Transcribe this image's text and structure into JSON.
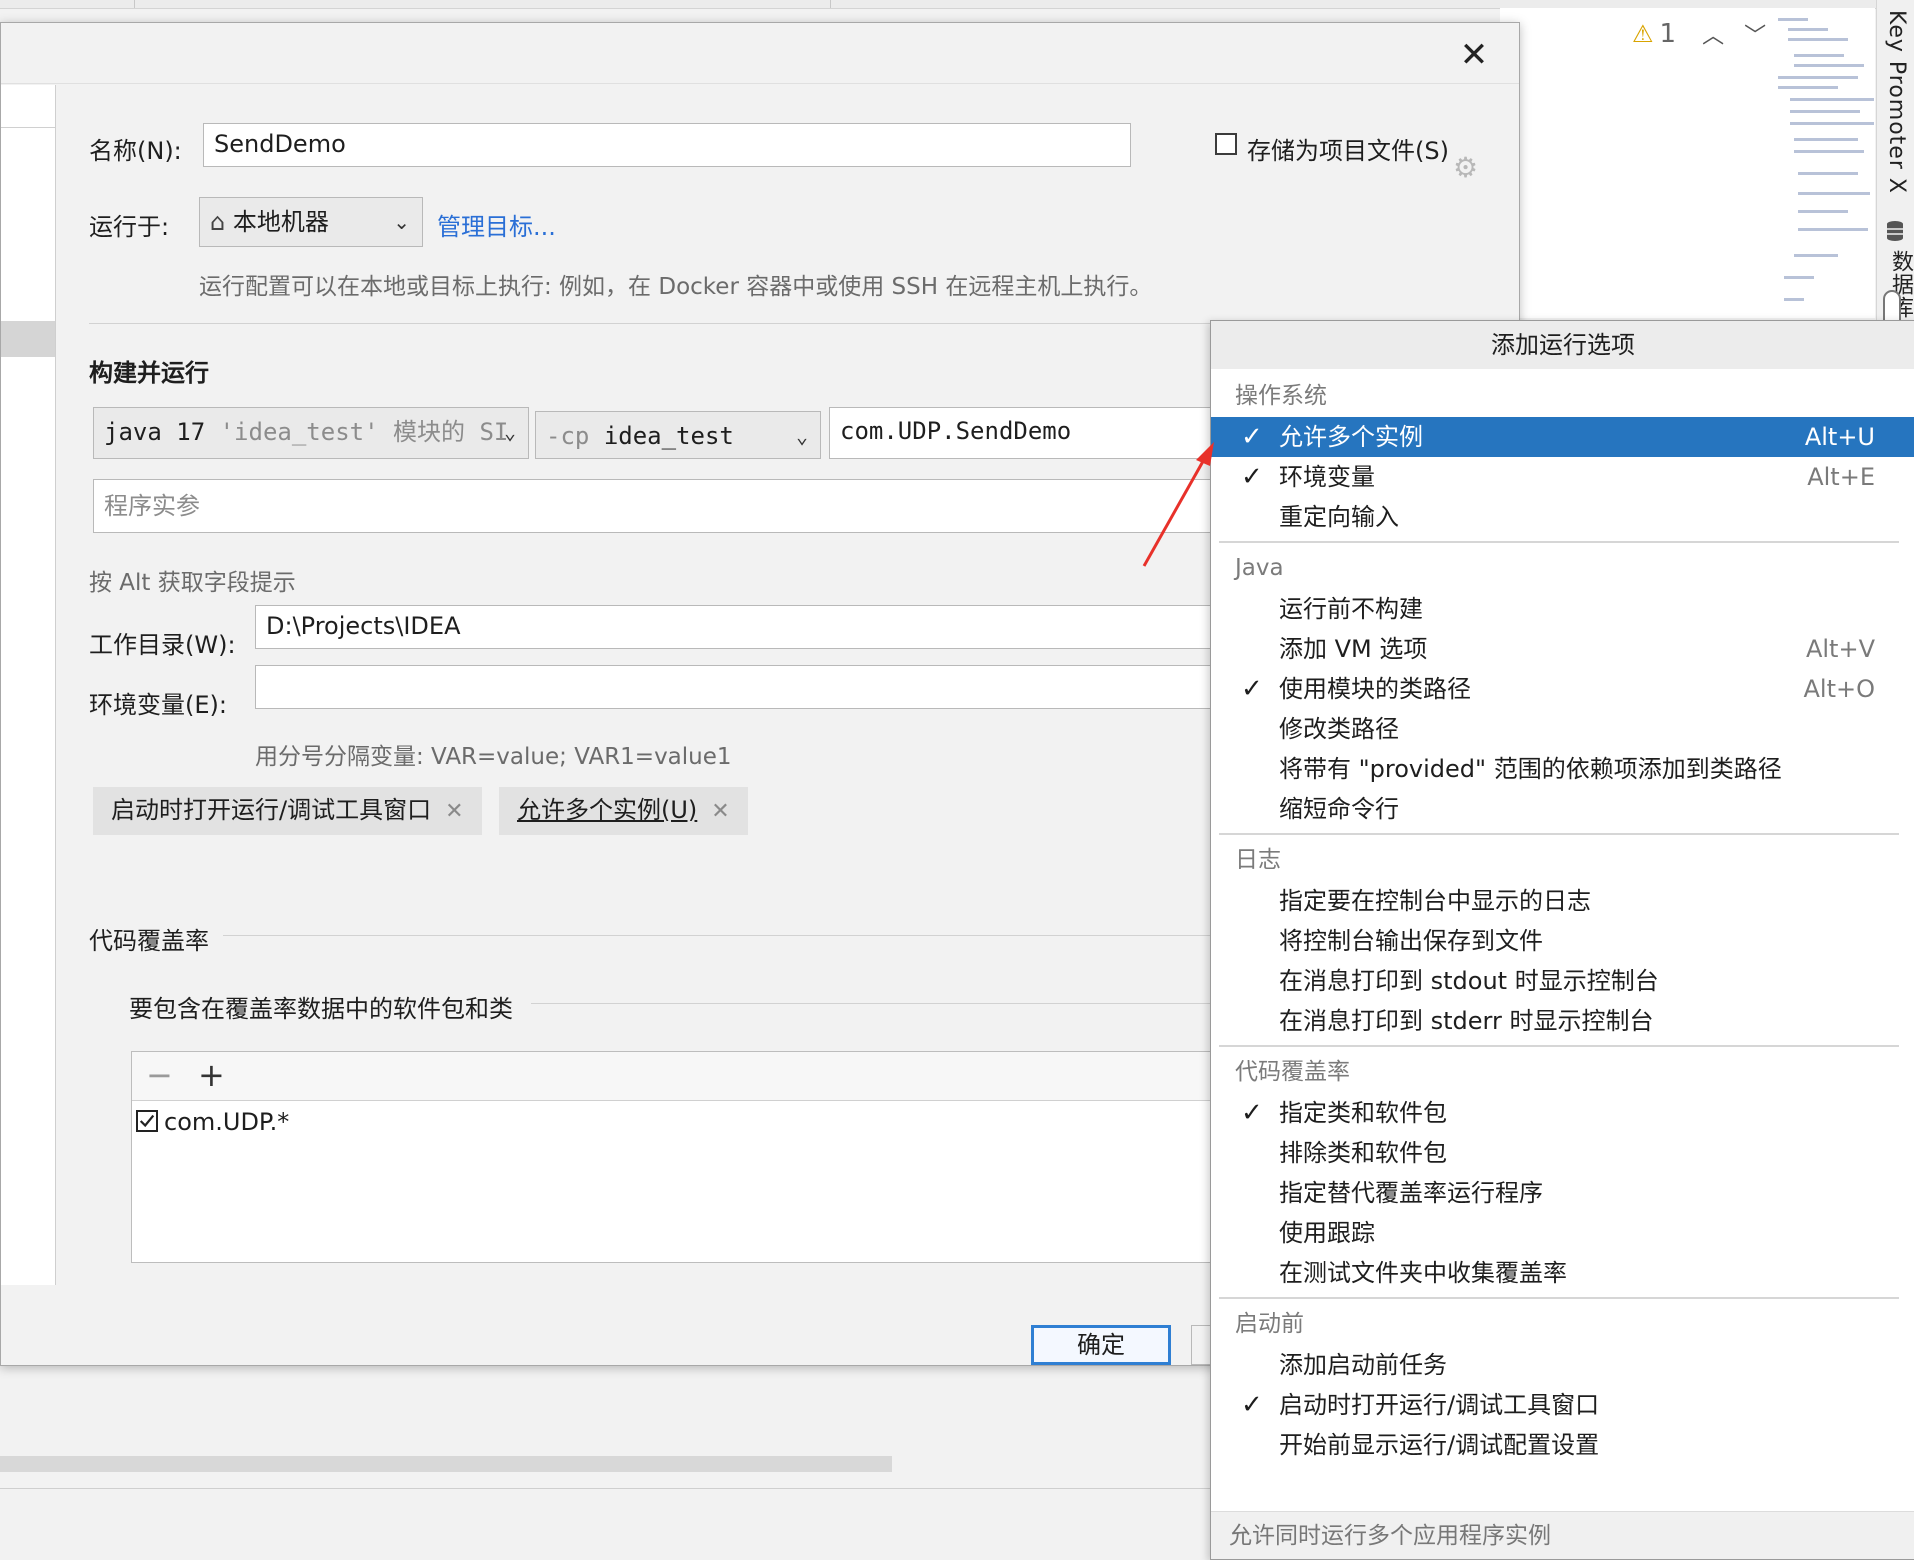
{
  "ide": {
    "warning_count": "1",
    "side_tab_key_promoter": "Key Promoter X",
    "side_tab_database": "数据库"
  },
  "dialog": {
    "name_label": "名称(N):",
    "name_value": "SendDemo",
    "store_as_project_file": "存储为项目文件(S)",
    "run_on_label": "运行于:",
    "run_on_value": "本地机器",
    "manage_targets": "管理目标...",
    "run_on_hint": "运行配置可以在本地或目标上执行: 例如，在 Docker 容器中或使用 SSH 在远程主机上执行。",
    "build_run_title": "构建并运行",
    "jre_main": "java 17",
    "jre_sub": "'idea_test' 模块的 SI",
    "cp_prefix": "-cp",
    "cp_value": "idea_test",
    "main_class": "com.UDP.SendDemo",
    "program_args_placeholder": "程序实参",
    "alt_hint": "按 Alt 获取字段提示",
    "workdir_label": "工作目录(W):",
    "workdir_value": "D:\\Projects\\IDEA",
    "env_label": "环境变量(E):",
    "env_value": "",
    "env_hint": "用分号分隔变量: VAR=value; VAR1=value1",
    "chip_open_tool_window": "启动时打开运行/调试工具窗口",
    "chip_allow_multiple": "允许多个实例(U)",
    "coverage_title": "代码覆盖率",
    "coverage_packages_title": "要包含在覆盖率数据中的软件包和类",
    "coverage_entry": "com.UDP.*",
    "ok_button": "确定"
  },
  "popup": {
    "title": "添加运行选项",
    "footer": "允许同时运行多个应用程序实例",
    "groups": [
      {
        "category": "操作系统",
        "items": [
          {
            "label": "允许多个实例",
            "shortcut": "Alt+U",
            "checked": true,
            "highlighted": true
          },
          {
            "label": "环境变量",
            "shortcut": "Alt+E",
            "checked": true
          },
          {
            "label": "重定向输入",
            "shortcut": "",
            "checked": false
          }
        ]
      },
      {
        "category": "Java",
        "items": [
          {
            "label": "运行前不构建",
            "shortcut": "",
            "checked": false
          },
          {
            "label": "添加 VM 选项",
            "shortcut": "Alt+V",
            "checked": false
          },
          {
            "label": "使用模块的类路径",
            "shortcut": "Alt+O",
            "checked": true
          },
          {
            "label": "修改类路径",
            "shortcut": "",
            "checked": false
          },
          {
            "label": "将带有 \"provided\" 范围的依赖项添加到类路径",
            "shortcut": "",
            "checked": false
          },
          {
            "label": "缩短命令行",
            "shortcut": "",
            "checked": false
          }
        ]
      },
      {
        "category": "日志",
        "items": [
          {
            "label": "指定要在控制台中显示的日志",
            "shortcut": "",
            "checked": false
          },
          {
            "label": "将控制台输出保存到文件",
            "shortcut": "",
            "checked": false
          },
          {
            "label": "在消息打印到 stdout 时显示控制台",
            "shortcut": "",
            "checked": false
          },
          {
            "label": "在消息打印到 stderr 时显示控制台",
            "shortcut": "",
            "checked": false
          }
        ]
      },
      {
        "category": "代码覆盖率",
        "items": [
          {
            "label": "指定类和软件包",
            "shortcut": "",
            "checked": true
          },
          {
            "label": "排除类和软件包",
            "shortcut": "",
            "checked": false
          },
          {
            "label": "指定替代覆盖率运行程序",
            "shortcut": "",
            "checked": false
          },
          {
            "label": "使用跟踪",
            "shortcut": "",
            "checked": false
          },
          {
            "label": "在测试文件夹中收集覆盖率",
            "shortcut": "",
            "checked": false
          }
        ]
      },
      {
        "category": "启动前",
        "items": [
          {
            "label": "添加启动前任务",
            "shortcut": "",
            "checked": false
          },
          {
            "label": "启动时打开运行/调试工具窗口",
            "shortcut": "",
            "checked": true
          },
          {
            "label": "开始前显示运行/调试配置设置",
            "shortcut": "",
            "checked": false
          }
        ]
      }
    ]
  },
  "colors": {
    "highlight": "#2675bf",
    "link": "#2a6fd6",
    "annotation_arrow": "#e8312a"
  }
}
